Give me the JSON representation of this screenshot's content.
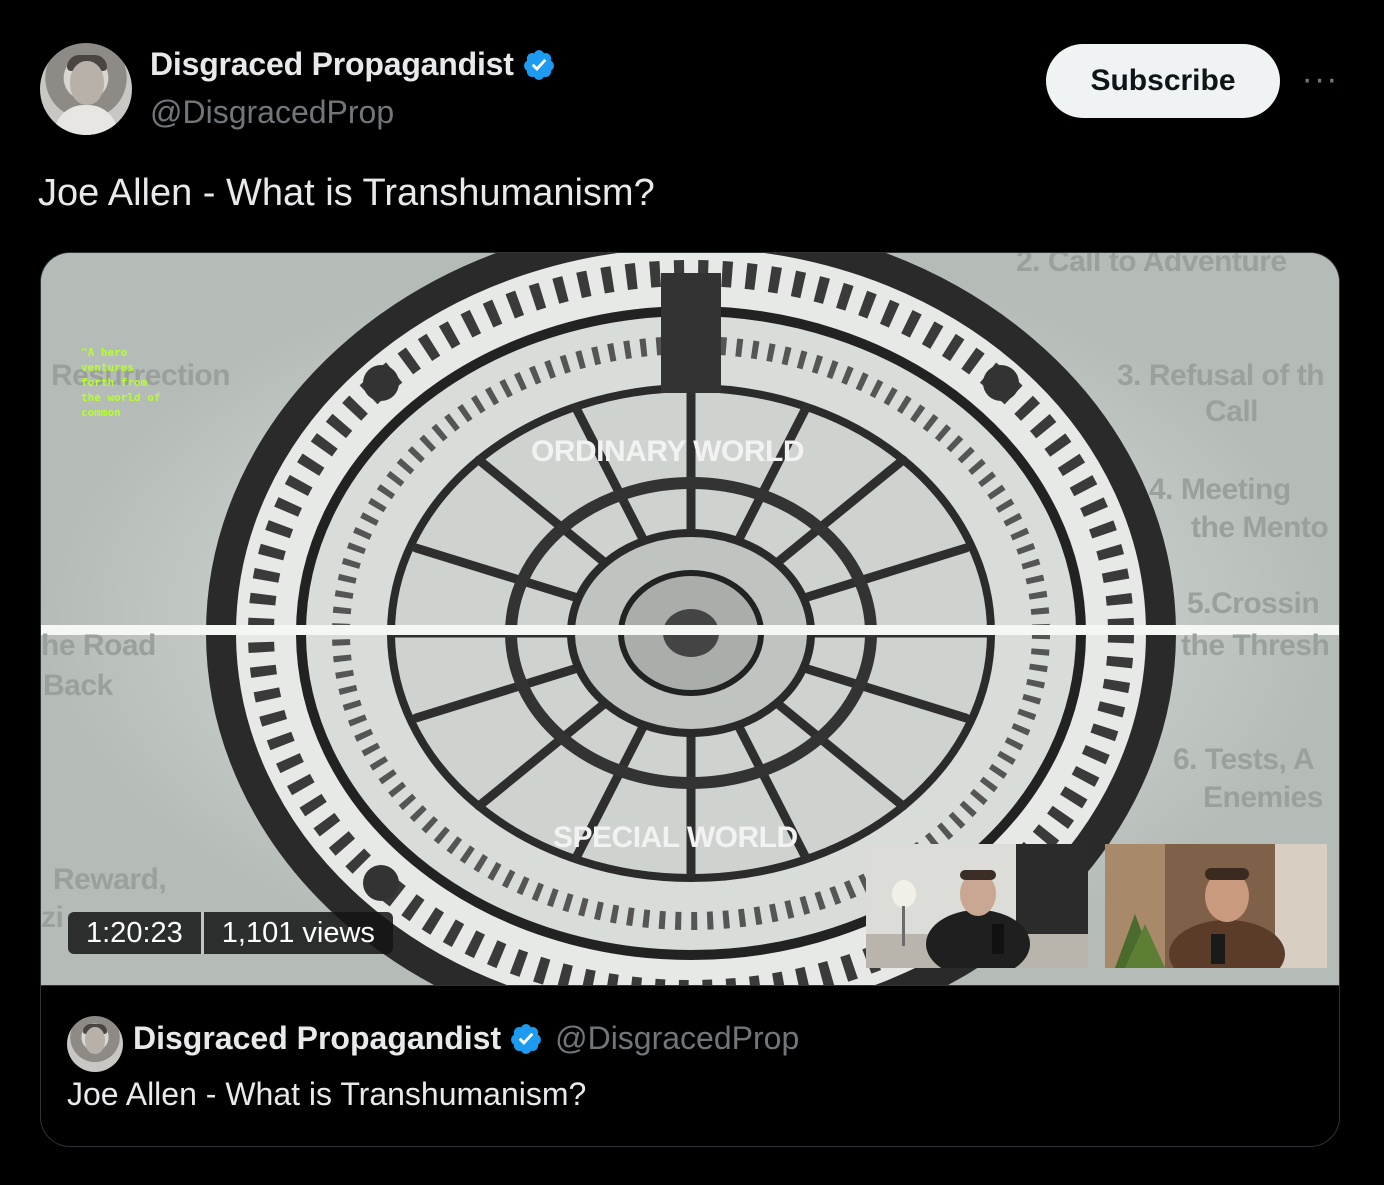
{
  "author": {
    "name": "Disgraced Propagandist",
    "handle": "@DisgracedProp",
    "verified": true
  },
  "actions": {
    "subscribe_label": "Subscribe",
    "more_label": "···"
  },
  "tweet": {
    "text": "Joe Allen - What is Transhumanism?"
  },
  "video": {
    "duration": "1:20:23",
    "views": "1,101 views",
    "overlay_labels": {
      "ordinary_world": "ORDINARY WORLD",
      "special_world": "SPECIAL WORLD",
      "call_to_adventure": "2. Call to Adventure",
      "refusal_1": "3. Refusal of th",
      "refusal_2": "Call",
      "meeting_1": "4. Meeting",
      "meeting_2": "the Mento",
      "crossing_1": "5.Crossin",
      "crossing_2": "the Thresh",
      "tests_1": "6. Tests, A",
      "tests_2": "Enemies",
      "resurrection": "Resurrection",
      "road_1": "he Road",
      "road_2": "Back",
      "reward_1": "Reward,",
      "reward_2": "zi"
    },
    "green_caption": [
      "\"A hero",
      "ventures",
      "forth from",
      "the world of",
      "common"
    ]
  },
  "quoted": {
    "name": "Disgraced Propagandist",
    "handle": "@DisgracedProp",
    "text": "Joe Allen - What is Transhumanism?"
  },
  "colors": {
    "background": "#000000",
    "text": "#e7e9ea",
    "muted": "#71767b",
    "verified_blue": "#1d9bf0",
    "button_bg": "#eff3f4",
    "border": "#2f3336"
  }
}
